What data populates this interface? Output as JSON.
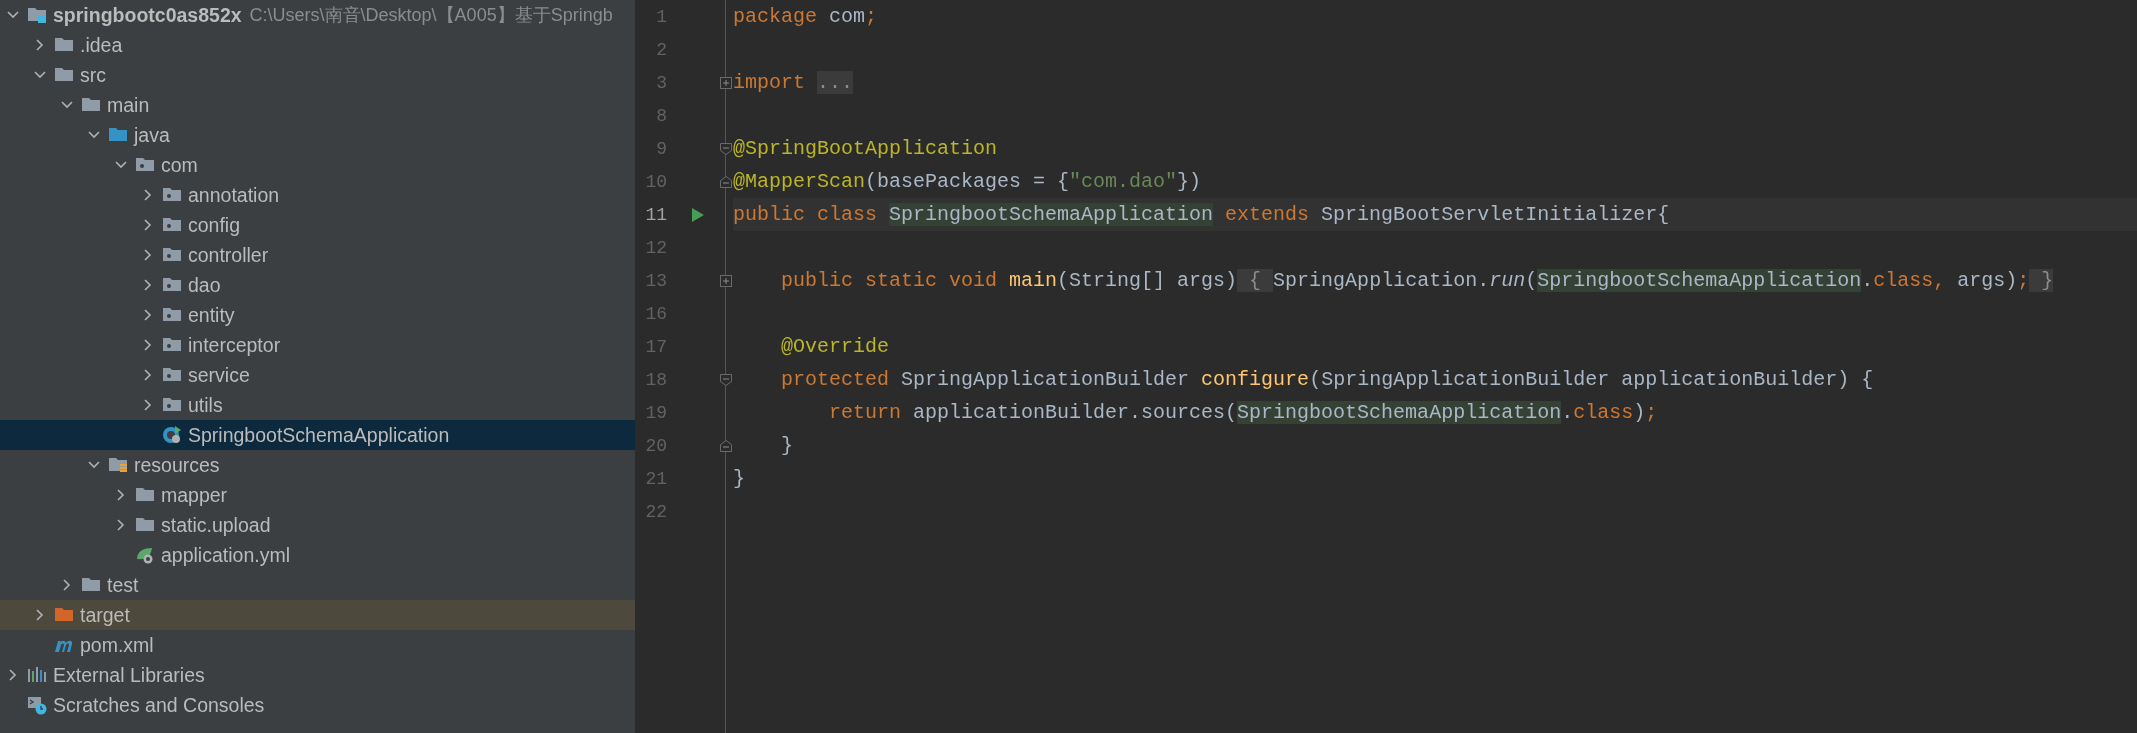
{
  "project_tree": {
    "items": [
      {
        "label": "springbootc0as852x",
        "kind": "module",
        "expanded": true,
        "selected": false,
        "excluded": false,
        "detail": "C:\\Users\\南音\\Desktop\\【A005】基于Springb",
        "children": [
          {
            "label": ".idea",
            "kind": "folder",
            "expanded": false,
            "selected": false,
            "excluded": false
          },
          {
            "label": "src",
            "kind": "folder",
            "expanded": true,
            "selected": false,
            "excluded": false,
            "children": [
              {
                "label": "main",
                "kind": "folder",
                "expanded": true,
                "selected": false,
                "excluded": false,
                "children": [
                  {
                    "label": "java",
                    "kind": "source-folder",
                    "expanded": true,
                    "selected": false,
                    "excluded": false,
                    "children": [
                      {
                        "label": "com",
                        "kind": "package",
                        "expanded": true,
                        "selected": false,
                        "excluded": false,
                        "children": [
                          {
                            "label": "annotation",
                            "kind": "package",
                            "expanded": false,
                            "selected": false,
                            "excluded": false
                          },
                          {
                            "label": "config",
                            "kind": "package",
                            "expanded": false,
                            "selected": false,
                            "excluded": false
                          },
                          {
                            "label": "controller",
                            "kind": "package",
                            "expanded": false,
                            "selected": false,
                            "excluded": false
                          },
                          {
                            "label": "dao",
                            "kind": "package",
                            "expanded": false,
                            "selected": false,
                            "excluded": false
                          },
                          {
                            "label": "entity",
                            "kind": "package",
                            "expanded": false,
                            "selected": false,
                            "excluded": false
                          },
                          {
                            "label": "interceptor",
                            "kind": "package",
                            "expanded": false,
                            "selected": false,
                            "excluded": false
                          },
                          {
                            "label": "service",
                            "kind": "package",
                            "expanded": false,
                            "selected": false,
                            "excluded": false
                          },
                          {
                            "label": "utils",
                            "kind": "package",
                            "expanded": false,
                            "selected": false,
                            "excluded": false
                          },
                          {
                            "label": "SpringbootSchemaApplication",
                            "kind": "spring-class",
                            "selected": true,
                            "excluded": false
                          }
                        ]
                      }
                    ]
                  },
                  {
                    "label": "resources",
                    "kind": "resources-folder",
                    "expanded": true,
                    "selected": false,
                    "excluded": false,
                    "children": [
                      {
                        "label": "mapper",
                        "kind": "folder",
                        "expanded": false,
                        "selected": false,
                        "excluded": false
                      },
                      {
                        "label": "static.upload",
                        "kind": "folder",
                        "expanded": false,
                        "selected": false,
                        "excluded": false
                      },
                      {
                        "label": "application.yml",
                        "kind": "spring-config",
                        "selected": false,
                        "excluded": false
                      }
                    ]
                  }
                ]
              },
              {
                "label": "test",
                "kind": "folder",
                "expanded": false,
                "selected": false,
                "excluded": false
              }
            ]
          },
          {
            "label": "target",
            "kind": "excluded-folder",
            "expanded": false,
            "selected": false,
            "excluded": true
          },
          {
            "label": "pom.xml",
            "kind": "maven",
            "selected": false,
            "excluded": false
          }
        ]
      },
      {
        "label": "External Libraries",
        "kind": "libraries",
        "expanded": false,
        "selected": false,
        "excluded": false
      },
      {
        "label": "Scratches and Consoles",
        "kind": "scratches",
        "selected": false,
        "excluded": false
      }
    ]
  },
  "editor": {
    "lines": [
      {
        "number": "1",
        "current": false,
        "kind": "plain",
        "tokens": [
          {
            "kind": "keyword",
            "text": "package"
          },
          {
            "kind": "plain",
            "text": " com"
          },
          {
            "kind": "keyword",
            "text": ";"
          }
        ]
      },
      {
        "number": "2",
        "current": false,
        "kind": "plain"
      },
      {
        "number": "3",
        "current": false,
        "kind": "fold-expand",
        "tokens": [
          {
            "kind": "keyword",
            "text": "import "
          },
          {
            "kind": "folded",
            "text": "..."
          }
        ]
      },
      {
        "number": "8",
        "current": false,
        "kind": "plain"
      },
      {
        "number": "9",
        "current": false,
        "kind": "fold-start",
        "tokens": [
          {
            "kind": "annotation",
            "text": "@SpringBootApplication"
          }
        ]
      },
      {
        "number": "10",
        "current": false,
        "kind": "fold-end",
        "tokens": [
          {
            "kind": "annotation",
            "text": "@MapperScan"
          },
          {
            "kind": "plain",
            "text": "(basePackages = {"
          },
          {
            "kind": "string",
            "text": "\"com.dao\""
          },
          {
            "kind": "plain",
            "text": "})"
          }
        ]
      },
      {
        "number": "11",
        "current": true,
        "run": true,
        "kind": "plain",
        "tokens": [
          {
            "kind": "keyword",
            "text": "public class "
          },
          {
            "kind": "highlight",
            "text": "SpringbootSchemaApplication"
          },
          {
            "kind": "keyword",
            "text": " extends"
          },
          {
            "kind": "plain",
            "text": " SpringBootServletInitializer{"
          }
        ]
      },
      {
        "number": "12",
        "current": false,
        "kind": "plain"
      },
      {
        "number": "13",
        "current": false,
        "kind": "fold-expand",
        "tokens": [
          {
            "kind": "keyword",
            "text": "    public static void "
          },
          {
            "kind": "method",
            "text": "main"
          },
          {
            "kind": "plain",
            "text": "(String[] args)"
          },
          {
            "kind": "folded",
            "text": " { "
          },
          {
            "kind": "plain",
            "text": "SpringApplication."
          },
          {
            "kind": "italic",
            "text": "run"
          },
          {
            "kind": "plain",
            "text": "("
          },
          {
            "kind": "highlight",
            "text": "SpringbootSchemaApplication"
          },
          {
            "kind": "plain",
            "text": "."
          },
          {
            "kind": "keyword",
            "text": "class,"
          },
          {
            "kind": "plain",
            "text": " args)"
          },
          {
            "kind": "keyword",
            "text": ";"
          },
          {
            "kind": "folded",
            "text": " }"
          }
        ]
      },
      {
        "number": "16",
        "current": false,
        "kind": "plain"
      },
      {
        "number": "17",
        "current": false,
        "kind": "plain",
        "tokens": [
          {
            "kind": "annotation",
            "text": "    @Override"
          }
        ]
      },
      {
        "number": "18",
        "current": false,
        "kind": "fold-start",
        "tokens": [
          {
            "kind": "keyword",
            "text": "    protected"
          },
          {
            "kind": "plain",
            "text": " SpringApplicationBuilder "
          },
          {
            "kind": "method",
            "text": "configure"
          },
          {
            "kind": "plain",
            "text": "(SpringApplicationBuilder applicationBuilder) {"
          }
        ]
      },
      {
        "number": "19",
        "current": false,
        "kind": "plain",
        "tokens": [
          {
            "kind": "keyword",
            "text": "        return"
          },
          {
            "kind": "plain",
            "text": " applicationBuilder.sources("
          },
          {
            "kind": "highlight",
            "text": "SpringbootSchemaApplication"
          },
          {
            "kind": "plain",
            "text": "."
          },
          {
            "kind": "keyword",
            "text": "class"
          },
          {
            "kind": "plain",
            "text": ")"
          },
          {
            "kind": "keyword",
            "text": ";"
          }
        ]
      },
      {
        "number": "20",
        "current": false,
        "kind": "fold-end",
        "tokens": [
          {
            "kind": "plain",
            "text": "    }"
          }
        ]
      },
      {
        "number": "21",
        "current": false,
        "kind": "plain",
        "tokens": [
          {
            "kind": "plain",
            "text": "}"
          }
        ]
      },
      {
        "number": "22",
        "current": false,
        "kind": "plain"
      }
    ]
  }
}
